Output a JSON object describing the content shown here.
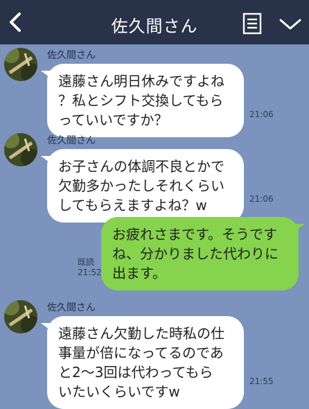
{
  "header": {
    "title": "佐久間さん"
  },
  "messages": [
    {
      "sender": "佐久間さん",
      "lines": [
        "遠藤さん明日休みですよね",
        "？私とシフト交換してもら",
        "っていいですか？"
      ],
      "time": "21:06"
    },
    {
      "sender": "佐久間さん",
      "lines": [
        "お子さんの体調不良とかで",
        "欠勤多かったしそれくらい",
        "してもらえますよね？w"
      ],
      "time": "21:06"
    },
    {
      "read_label": "既読",
      "lines": [
        "お疲れさまです。そうです",
        "ね、分かりました代わりに",
        "出ます。"
      ],
      "time": "21:52"
    },
    {
      "sender": "佐久間さん",
      "lines": [
        "遠藤さん欠勤した時私の仕",
        "事量が倍になってるのであ",
        "と2〜3回は代わってもら",
        "いたいくらいですw"
      ],
      "time": "21:55"
    }
  ],
  "colors": {
    "background": "#7b93bd",
    "header": "#283248",
    "incoming_bubble": "#ffffff",
    "outgoing_bubble": "#86d34d"
  },
  "icons": {
    "back": "chevron-left-icon",
    "memo": "note-icon",
    "menu": "chevron-down-icon",
    "avatar": "contact-avatar"
  }
}
